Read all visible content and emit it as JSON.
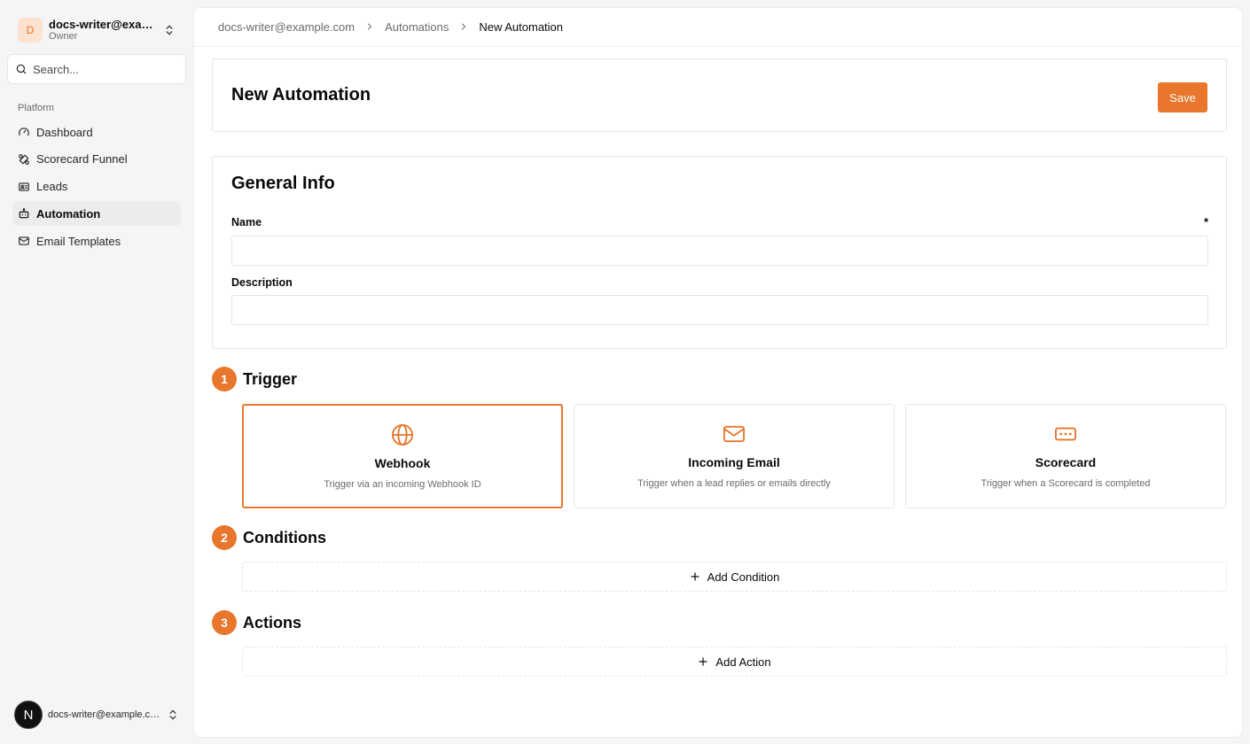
{
  "account": {
    "initial": "D",
    "name": "docs-writer@example.com",
    "role": "Owner"
  },
  "search": {
    "placeholder": "Search..."
  },
  "sidebar": {
    "group_label": "Platform",
    "items": [
      {
        "label": "Dashboard",
        "icon": "gauge-icon"
      },
      {
        "label": "Scorecard Funnel",
        "icon": "scorecard-funnel-icon"
      },
      {
        "label": "Leads",
        "icon": "id-card-icon"
      },
      {
        "label": "Automation",
        "icon": "bot-icon",
        "active": true
      },
      {
        "label": "Email Templates",
        "icon": "mail-icon"
      }
    ]
  },
  "user": {
    "initial": "N",
    "email": "docs-writer@example.com"
  },
  "breadcrumb": {
    "items": [
      "docs-writer@example.com",
      "Automations",
      "New Automation"
    ]
  },
  "header": {
    "title": "New Automation",
    "save_label": "Save"
  },
  "general_info": {
    "title": "General Info",
    "name_label": "Name",
    "required_mark": "*",
    "name_value": "",
    "description_label": "Description",
    "description_value": ""
  },
  "steps": {
    "trigger": {
      "number": "1",
      "title": "Trigger"
    },
    "conditions": {
      "number": "2",
      "title": "Conditions",
      "add_label": "Add Condition"
    },
    "actions": {
      "number": "3",
      "title": "Actions",
      "add_label": "Add Action"
    }
  },
  "triggers": [
    {
      "name": "Webhook",
      "desc": "Trigger via an incoming Webhook ID",
      "icon": "globe-icon",
      "selected": true
    },
    {
      "name": "Incoming Email",
      "desc": "Trigger when a lead replies or emails directly",
      "icon": "mail-icon",
      "selected": false
    },
    {
      "name": "Scorecard",
      "desc": "Trigger when a Scorecard is completed",
      "icon": "rectangle-ellipsis-icon",
      "selected": false
    }
  ],
  "colors": {
    "accent": "#e8762c",
    "border": "#e5e5e5",
    "muted_text": "#6b6b6b"
  }
}
